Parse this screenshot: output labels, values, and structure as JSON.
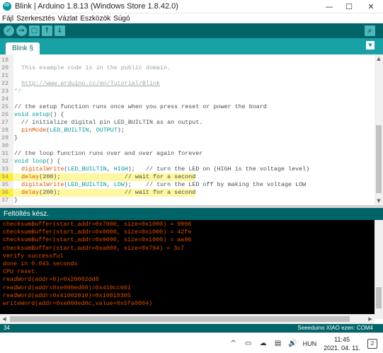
{
  "window": {
    "title": "Blink | Arduino 1.8.13 (Windows Store 1.8.42.0)",
    "minimize": "—",
    "maximize": "☐",
    "close": "✕"
  },
  "menu": [
    "Fájl",
    "Szerkesztés",
    "Vázlat",
    "Eszközök",
    "Súgó"
  ],
  "toolbar": {
    "verify_icon": "✓",
    "upload_icon": "→",
    "new_icon": "▢",
    "open_icon": "↑",
    "save_icon": "↓",
    "serial_monitor_icon": "⌕"
  },
  "tab": {
    "label": "Blink §",
    "menu_icon": "▼"
  },
  "editor": {
    "highlight_color": "#ffef33",
    "lines": [
      {
        "n": "19",
        "hl": false,
        "parts": [
          {
            "t": "",
            "c": "plain"
          }
        ]
      },
      {
        "n": "20",
        "hl": false,
        "parts": [
          {
            "t": "  This example code is in the public domain.",
            "c": "comment"
          }
        ]
      },
      {
        "n": "21",
        "hl": false,
        "parts": [
          {
            "t": "",
            "c": "plain"
          }
        ]
      },
      {
        "n": "22",
        "hl": false,
        "parts": [
          {
            "t": "  ",
            "c": "plain"
          },
          {
            "t": "http://www.arduino.cc/en/Tutorial/Blink",
            "c": "link"
          }
        ]
      },
      {
        "n": "23",
        "hl": false,
        "parts": [
          {
            "t": "*/",
            "c": "comment"
          }
        ]
      },
      {
        "n": "24",
        "hl": false,
        "parts": [
          {
            "t": "",
            "c": "plain"
          }
        ]
      },
      {
        "n": "25",
        "hl": false,
        "parts": [
          {
            "t": "// the setup function runs once when you press reset or power the board",
            "c": "plain"
          }
        ]
      },
      {
        "n": "26",
        "hl": false,
        "parts": [
          {
            "t": "void",
            "c": "kw"
          },
          {
            "t": " ",
            "c": "plain"
          },
          {
            "t": "setup",
            "c": "kw"
          },
          {
            "t": "() {",
            "c": "plain"
          }
        ]
      },
      {
        "n": "27",
        "hl": false,
        "parts": [
          {
            "t": "  // initialize digital pin LED_BUILTIN as an output.",
            "c": "plain"
          }
        ]
      },
      {
        "n": "28",
        "hl": false,
        "parts": [
          {
            "t": "  ",
            "c": "plain"
          },
          {
            "t": "pinMode",
            "c": "fn"
          },
          {
            "t": "(",
            "c": "plain"
          },
          {
            "t": "LED_BUILTIN",
            "c": "const"
          },
          {
            "t": ", ",
            "c": "plain"
          },
          {
            "t": "OUTPUT",
            "c": "const"
          },
          {
            "t": ");",
            "c": "plain"
          }
        ]
      },
      {
        "n": "29",
        "hl": false,
        "parts": [
          {
            "t": "}",
            "c": "plain"
          }
        ]
      },
      {
        "n": "30",
        "hl": false,
        "parts": [
          {
            "t": "",
            "c": "plain"
          }
        ]
      },
      {
        "n": "31",
        "hl": false,
        "parts": [
          {
            "t": "// the loop function runs over and over again forever",
            "c": "plain"
          }
        ]
      },
      {
        "n": "32",
        "hl": false,
        "parts": [
          {
            "t": "void",
            "c": "kw"
          },
          {
            "t": " ",
            "c": "plain"
          },
          {
            "t": "loop",
            "c": "kw"
          },
          {
            "t": "() {",
            "c": "plain"
          }
        ]
      },
      {
        "n": "33",
        "hl": false,
        "parts": [
          {
            "t": "  ",
            "c": "plain"
          },
          {
            "t": "digitalWrite",
            "c": "fn"
          },
          {
            "t": "(",
            "c": "plain"
          },
          {
            "t": "LED_BUILTIN",
            "c": "const"
          },
          {
            "t": ", ",
            "c": "plain"
          },
          {
            "t": "HIGH",
            "c": "const"
          },
          {
            "t": ");   // turn the LED on (HIGH is the voltage level)",
            "c": "plain"
          }
        ]
      },
      {
        "n": "34",
        "hl": true,
        "parts": [
          {
            "t": "  ",
            "c": "plain"
          },
          {
            "t": "delay",
            "c": "fn"
          },
          {
            "t": "(200);",
            "c": "plain"
          },
          {
            "t": "                  // wait for a second",
            "c": "plain"
          }
        ]
      },
      {
        "n": "35",
        "hl": false,
        "parts": [
          {
            "t": "  ",
            "c": "plain"
          },
          {
            "t": "digitalWrite",
            "c": "fn"
          },
          {
            "t": "(",
            "c": "plain"
          },
          {
            "t": "LED_BUILTIN",
            "c": "const"
          },
          {
            "t": ", ",
            "c": "plain"
          },
          {
            "t": "LOW",
            "c": "const"
          },
          {
            "t": ");    // turn the LED off by making the voltage LOW",
            "c": "plain"
          }
        ]
      },
      {
        "n": "36",
        "hl": true,
        "parts": [
          {
            "t": "  ",
            "c": "plain"
          },
          {
            "t": "delay",
            "c": "fn"
          },
          {
            "t": "(200);",
            "c": "plain"
          },
          {
            "t": "                  // wait for a second",
            "c": "plain"
          }
        ]
      },
      {
        "n": "37",
        "hl": false,
        "parts": [
          {
            "t": "}",
            "c": "plain"
          }
        ]
      }
    ]
  },
  "status": {
    "message": "Feltöltés kész."
  },
  "console": {
    "text_color": "#e34c00",
    "lines": [
      "checksumBuffer(start_addr=0x7000, size=0x1000) = 9996",
      "checksumBuffer(start_addr=0x8000, size=0x1000) = 42fe",
      "checksumBuffer(start_addr=0x9000, size=0x1000) = aa96",
      "checksumBuffer(start_addr=0xa000, size=0x794) = 3c7",
      "Verify successful",
      "done in 0.043 seconds",
      "CPU reset.",
      "readWord(addr=0)=0x20002dd8",
      "readWord(addr=0xe000ed00)=0x410cc601",
      "readWord(addr=0x41002018)=0x10010305",
      "writeWord(addr=0xe000ed0c,value=0x5fa0004)"
    ]
  },
  "bottom": {
    "line_number": "34",
    "board": "Seeeduino XIAO ezen: COM4"
  },
  "taskbar": {
    "chevron": "^",
    "language": "HUN",
    "time": "11:45",
    "date": "2021. 04. 11.",
    "notification_count": "2"
  },
  "colors": {
    "toolbar_bg": "#006468",
    "tabbar_bg": "#17a1a5",
    "console_bg": "#000000"
  }
}
